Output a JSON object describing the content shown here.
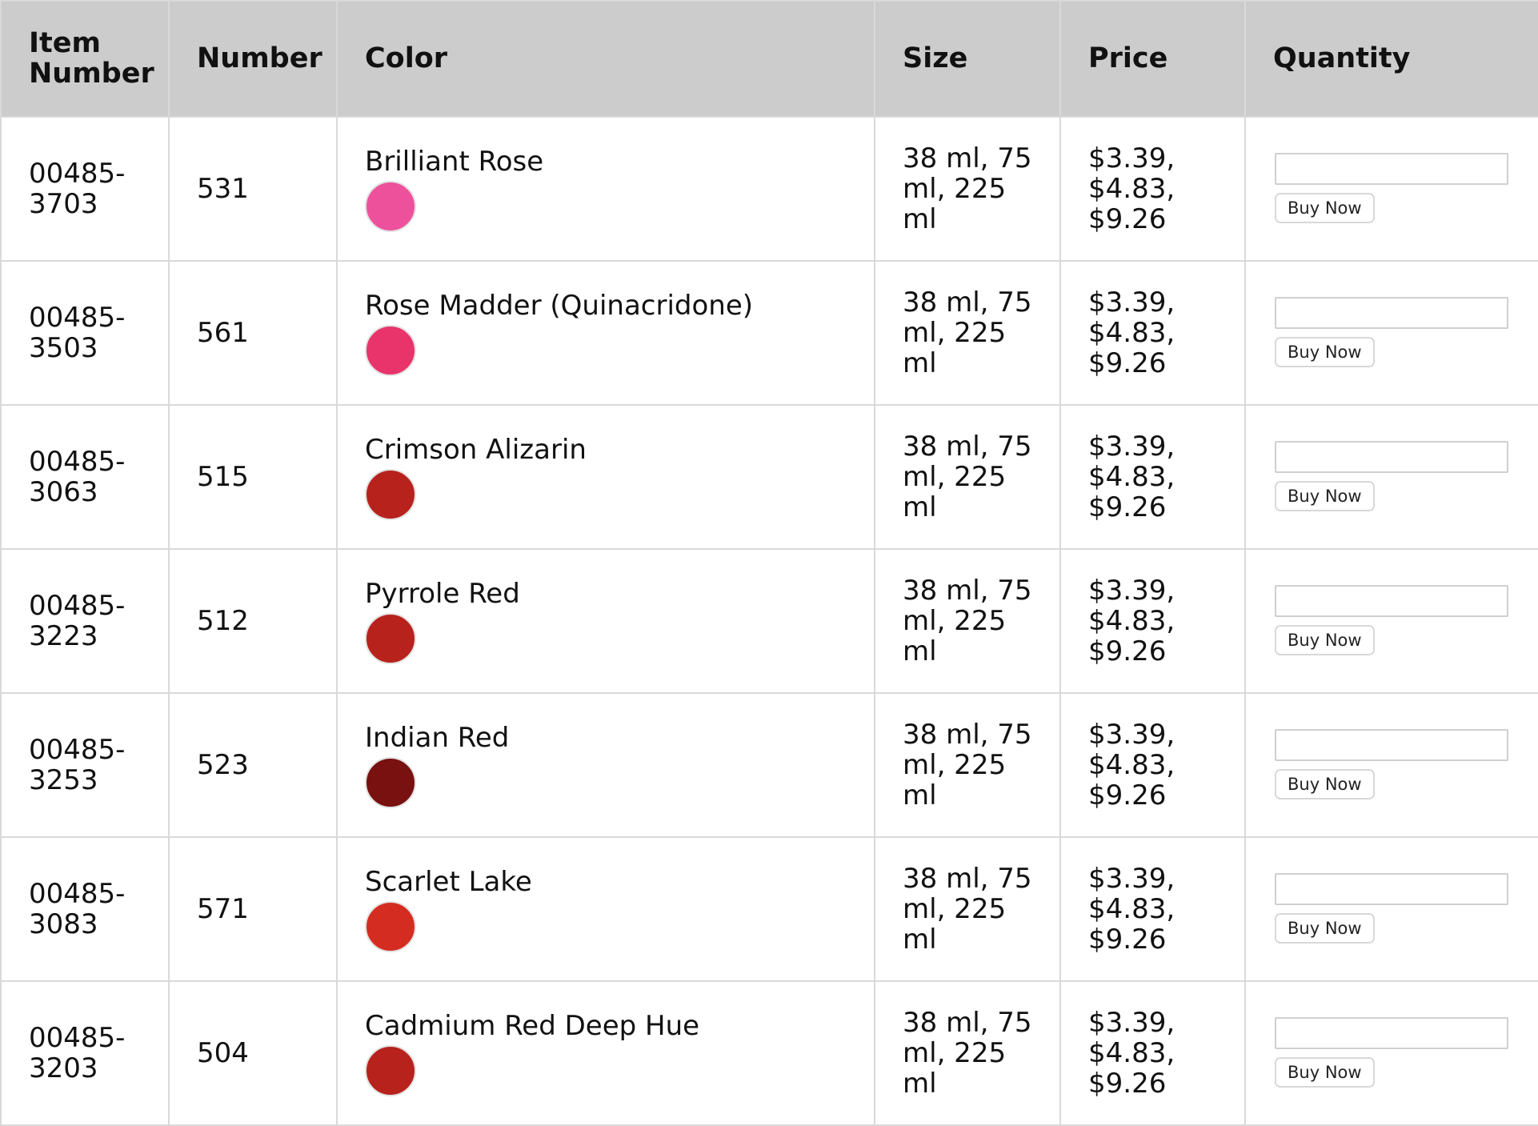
{
  "table": {
    "headers": {
      "item_number": "Item Number",
      "number": "Number",
      "color": "Color",
      "size": "Size",
      "price": "Price",
      "quantity": "Quantity"
    },
    "buy_label": "Buy Now",
    "rows": [
      {
        "item_number": "00485-3703",
        "number": "531",
        "color_name": "Brilliant Rose",
        "swatch": "#ee519c",
        "size": "38 ml, 75 ml, 225 ml",
        "price": "$3.39, $4.83, $9.26",
        "quantity": ""
      },
      {
        "item_number": "00485-3503",
        "number": "561",
        "color_name": "Rose Madder (Quinacridone)",
        "swatch": "#e9336b",
        "size": "38 ml, 75 ml, 225 ml",
        "price": "$3.39, $4.83, $9.26",
        "quantity": ""
      },
      {
        "item_number": "00485-3063",
        "number": "515",
        "color_name": "Crimson Alizarin",
        "swatch": "#b8221c",
        "size": "38 ml, 75 ml, 225 ml",
        "price": "$3.39, $4.83, $9.26",
        "quantity": ""
      },
      {
        "item_number": "00485-3223",
        "number": "512",
        "color_name": "Pyrrole Red",
        "swatch": "#b8221c",
        "size": "38 ml, 75 ml, 225 ml",
        "price": "$3.39, $4.83, $9.26",
        "quantity": ""
      },
      {
        "item_number": "00485-3253",
        "number": "523",
        "color_name": "Indian Red",
        "swatch": "#78110f",
        "size": "38 ml, 75 ml, 225 ml",
        "price": "$3.39, $4.83, $9.26",
        "quantity": ""
      },
      {
        "item_number": "00485-3083",
        "number": "571",
        "color_name": "Scarlet Lake",
        "swatch": "#d52c21",
        "size": "38 ml, 75 ml, 225 ml",
        "price": "$3.39, $4.83, $9.26",
        "quantity": ""
      },
      {
        "item_number": "00485-3203",
        "number": "504",
        "color_name": "Cadmium Red Deep Hue",
        "swatch": "#b8221c",
        "size": "38 ml, 75 ml, 225 ml",
        "price": "$3.39, $4.83, $9.26",
        "quantity": ""
      }
    ]
  }
}
